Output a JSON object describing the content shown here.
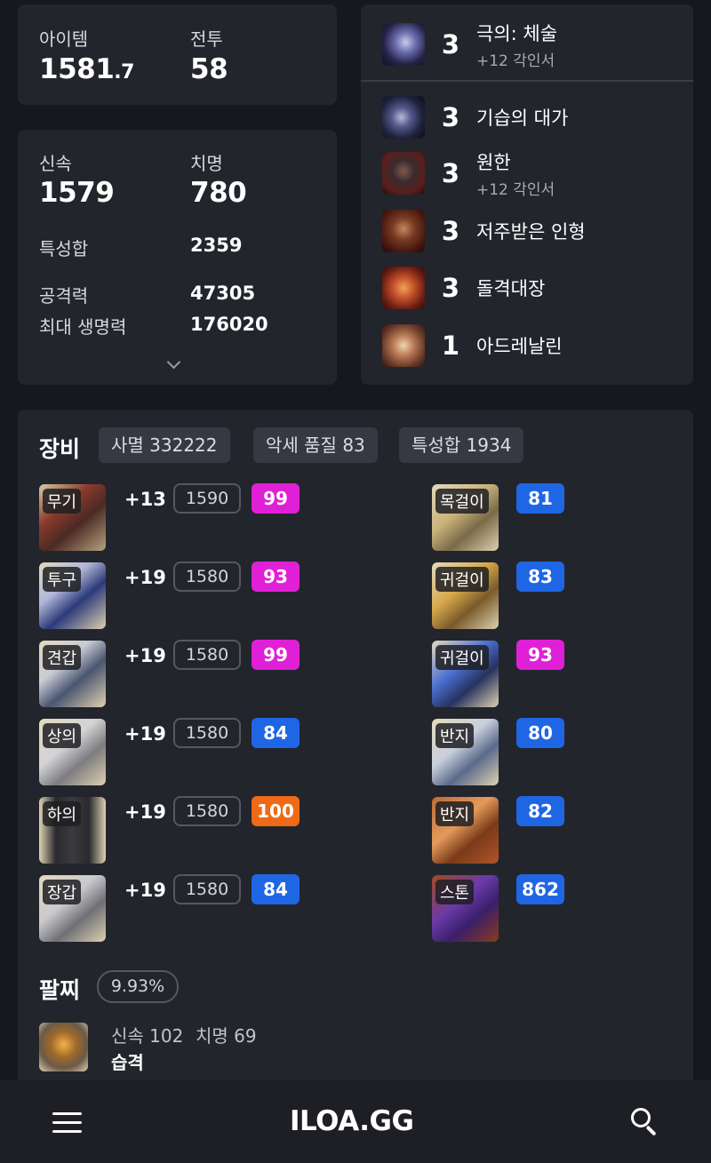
{
  "stats": {
    "item_label": "아이템",
    "item_value_main": "1581",
    "item_value_dec": ".7",
    "combat_label": "전투",
    "combat_value": "58",
    "swiftness_label": "신속",
    "swiftness_value": "1579",
    "crit_label": "치명",
    "crit_value": "780",
    "trait_sum_label": "특성합",
    "trait_sum_value": "2359",
    "attack_label": "공격력",
    "attack_value": "47305",
    "maxhp_label": "최대 생명력",
    "maxhp_value": "176020"
  },
  "engravings": [
    {
      "level": "3",
      "name": "극의: 체술",
      "sub": "+12 각인서",
      "icon": "fist-engraving-icon"
    },
    {
      "level": "3",
      "name": "기습의 대가",
      "sub": "",
      "icon": "ambush-engraving-icon"
    },
    {
      "level": "3",
      "name": "원한",
      "sub": "+12 각인서",
      "icon": "grudge-engraving-icon"
    },
    {
      "level": "3",
      "name": "저주받은 인형",
      "sub": "",
      "icon": "cursed-doll-engraving-icon"
    },
    {
      "level": "3",
      "name": "돌격대장",
      "sub": "",
      "icon": "raid-captain-engraving-icon"
    },
    {
      "level": "1",
      "name": "아드레날린",
      "sub": "",
      "icon": "adrenaline-engraving-icon"
    }
  ],
  "equipment": {
    "title": "장비",
    "chips": [
      "사멸 332222",
      "악세 품질 83",
      "특성합 1934"
    ],
    "armor": [
      {
        "tag": "무기",
        "plus": "+13",
        "ilvl": "1590",
        "quality": "99",
        "qcolor": "pink"
      },
      {
        "tag": "투구",
        "plus": "+19",
        "ilvl": "1580",
        "quality": "93",
        "qcolor": "pink"
      },
      {
        "tag": "견갑",
        "plus": "+19",
        "ilvl": "1580",
        "quality": "99",
        "qcolor": "pink"
      },
      {
        "tag": "상의",
        "plus": "+19",
        "ilvl": "1580",
        "quality": "84",
        "qcolor": "blue"
      },
      {
        "tag": "하의",
        "plus": "+19",
        "ilvl": "1580",
        "quality": "100",
        "qcolor": "orange"
      },
      {
        "tag": "장갑",
        "plus": "+19",
        "ilvl": "1580",
        "quality": "84",
        "qcolor": "blue"
      }
    ],
    "accessories": [
      {
        "tag": "목걸이",
        "quality": "81",
        "qcolor": "blue"
      },
      {
        "tag": "귀걸이",
        "quality": "83",
        "qcolor": "blue"
      },
      {
        "tag": "귀걸이",
        "quality": "93",
        "qcolor": "pink"
      },
      {
        "tag": "반지",
        "quality": "80",
        "qcolor": "blue"
      },
      {
        "tag": "반지",
        "quality": "82",
        "qcolor": "blue"
      },
      {
        "tag": "스톤",
        "quality": "862",
        "qcolor": "blue"
      }
    ]
  },
  "bracelet": {
    "title": "팔찌",
    "percent": "9.93%",
    "stat1": "신속 102",
    "stat2": "치명 69",
    "effect": "습격"
  },
  "nav": {
    "logo": "ILOA.GG"
  },
  "colors": {
    "pink": "#e020d6",
    "blue": "#1f66e5",
    "orange": "#ef6a17",
    "card": "#23252c",
    "background": "#17181d"
  }
}
